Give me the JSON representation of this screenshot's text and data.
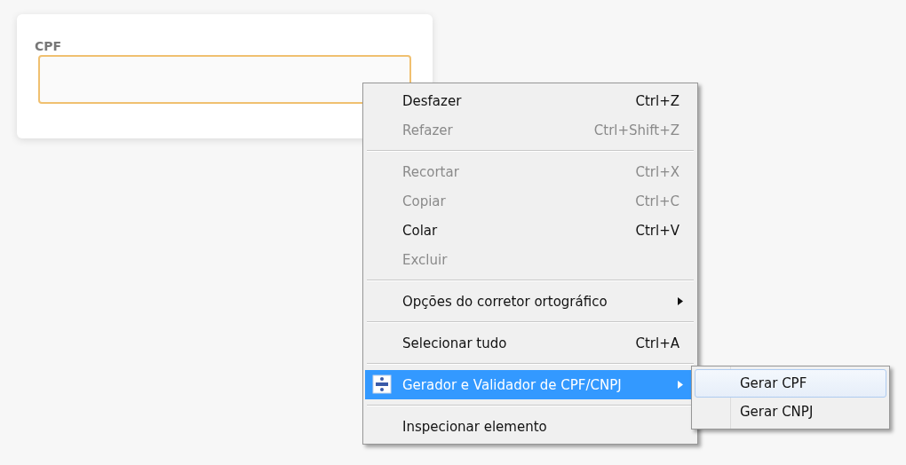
{
  "form": {
    "label": "CPF",
    "focused": true
  },
  "context_menu": {
    "items": [
      {
        "kind": "item",
        "label": "Desfazer",
        "shortcut": "Ctrl+Z",
        "disabled": false,
        "selected": false
      },
      {
        "kind": "item",
        "label": "Refazer",
        "shortcut": "Ctrl+Shift+Z",
        "disabled": true,
        "selected": false
      },
      {
        "kind": "separator"
      },
      {
        "kind": "item",
        "label": "Recortar",
        "shortcut": "Ctrl+X",
        "disabled": true,
        "selected": false
      },
      {
        "kind": "item",
        "label": "Copiar",
        "shortcut": "Ctrl+C",
        "disabled": true,
        "selected": false
      },
      {
        "kind": "item",
        "label": "Colar",
        "shortcut": "Ctrl+V",
        "disabled": false,
        "selected": false
      },
      {
        "kind": "item",
        "label": "Excluir",
        "disabled": true,
        "selected": false
      },
      {
        "kind": "separator"
      },
      {
        "kind": "submenu",
        "label": "Opções do corretor ortográfico",
        "disabled": false,
        "selected": false
      },
      {
        "kind": "separator"
      },
      {
        "kind": "item",
        "label": "Selecionar tudo",
        "shortcut": "Ctrl+A",
        "disabled": false,
        "selected": false
      },
      {
        "kind": "separator"
      },
      {
        "kind": "extension",
        "label": "Gerador e Validador de CPF/CNPJ",
        "disabled": false,
        "selected": true
      },
      {
        "kind": "separator"
      },
      {
        "kind": "item",
        "label": "Inspecionar elemento",
        "disabled": false,
        "selected": false
      }
    ]
  },
  "submenu": {
    "items": [
      {
        "label": "Gerar CPF",
        "selected": true
      },
      {
        "label": "Gerar CNPJ",
        "selected": false
      }
    ]
  }
}
